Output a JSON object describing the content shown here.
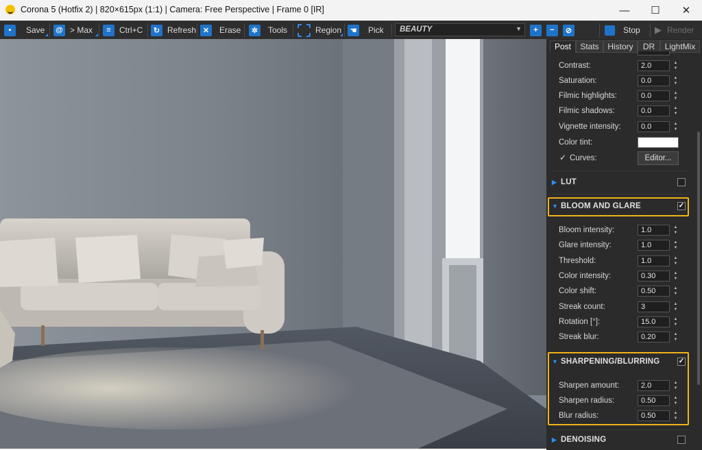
{
  "window": {
    "title": "Corona 5 (Hotfix 2) | 820×615px (1:1) | Camera: Free Perspective | Frame 0 [IR]",
    "minimize": "—",
    "maximize": "☐",
    "close": "✕"
  },
  "toolbar": {
    "save": "Save",
    "max": "> Max",
    "copy": "Ctrl+C",
    "refresh": "Refresh",
    "erase": "Erase",
    "tools": "Tools",
    "region": "Region",
    "pick": "Pick",
    "channel": "BEAUTY",
    "stop": "Stop",
    "render": "Render"
  },
  "panel": {
    "tabs": [
      "Post",
      "Stats",
      "History",
      "DR",
      "LightMix"
    ],
    "active_tab": "Post",
    "tone": [
      {
        "label": "Contrast:",
        "value": "2.0"
      },
      {
        "label": "Saturation:",
        "value": "0.0"
      },
      {
        "label": "Filmic highlights:",
        "value": "0.0"
      },
      {
        "label": "Filmic shadows:",
        "value": "0.0"
      },
      {
        "label": "Vignette intensity:",
        "value": "0.0"
      }
    ],
    "color_tint_label": "Color tint:",
    "color_tint_value": "#ffffff",
    "curves_label": "Curves:",
    "curves_checked": "✓",
    "editor_button": "Editor...",
    "lut_title": "LUT",
    "bloom": {
      "title": "BLOOM AND GLARE",
      "checked": "✓",
      "rows": [
        {
          "label": "Bloom intensity:",
          "value": "1.0"
        },
        {
          "label": "Glare intensity:",
          "value": "1.0"
        },
        {
          "label": "Threshold:",
          "value": "1.0"
        },
        {
          "label": "Color intensity:",
          "value": "0.30"
        },
        {
          "label": "Color shift:",
          "value": "0.50"
        },
        {
          "label": "Streak count:",
          "value": "3"
        },
        {
          "label": "Rotation [°]:",
          "value": "15.0"
        },
        {
          "label": "Streak blur:",
          "value": "0.20"
        }
      ]
    },
    "sharpen": {
      "title": "SHARPENING/BLURRING",
      "checked": "✓",
      "rows": [
        {
          "label": "Sharpen amount:",
          "value": "2.0"
        },
        {
          "label": "Sharpen radius:",
          "value": "0.50"
        },
        {
          "label": "Blur radius:",
          "value": "0.50"
        }
      ]
    },
    "denoising_title": "DENOISING",
    "highlight_color": "#f0b21a",
    "accent_color": "#2f8cf0"
  }
}
